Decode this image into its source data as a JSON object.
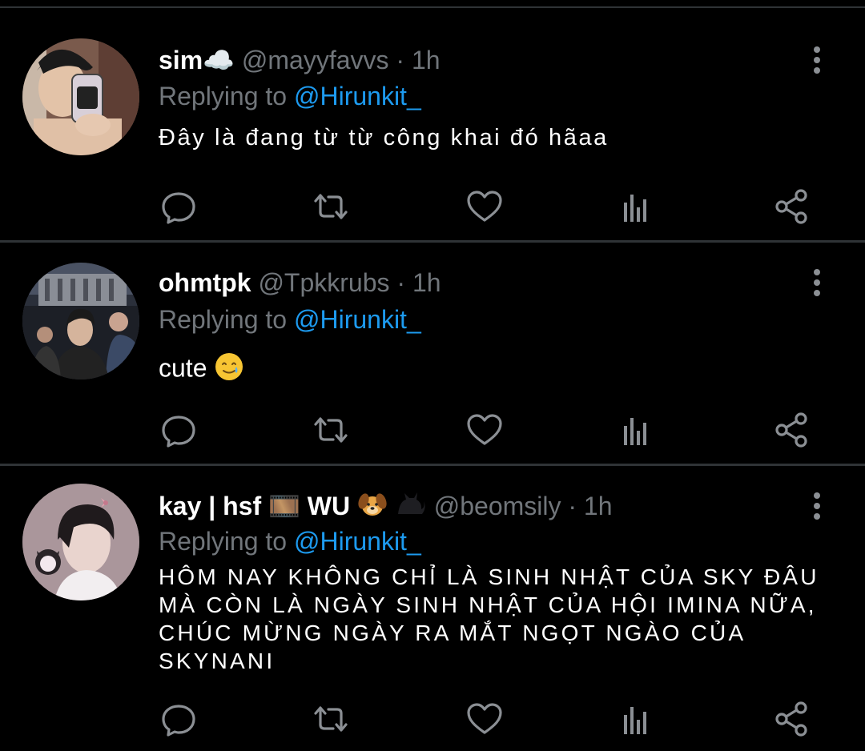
{
  "tweets": [
    {
      "name": "sim☁️",
      "handle": "@mayyfavvs",
      "dot": "·",
      "time": "1h",
      "replying_prefix": "Replying to",
      "mention": "@Hirunkit_",
      "text": "Đây là đang từ từ công khai đó hãaa"
    },
    {
      "name": "ohmtpk",
      "handle": "@Tpkkrubs",
      "dot": "·",
      "time": "1h",
      "replying_prefix": "Replying to",
      "mention": "@Hirunkit_",
      "text": "cute"
    },
    {
      "name": "kay | hsf 🎞️ WU",
      "handle": "@beomsily",
      "dot": "·",
      "time": "1h",
      "replying_prefix": "Replying to",
      "mention": "@Hirunkit_",
      "text": "HÔM NAY KHÔNG CHỈ LÀ SINH NHẬT CỦA SKY ĐÂU MÀ CÒN LÀ NGÀY SINH NHẬT CỦA HỘI IMINA NỮA, CHÚC MỪNG NGÀY RA MẮT NGỌT NGÀO CỦA SKYNANI"
    }
  ],
  "icons": {
    "reply": "reply-icon",
    "retweet": "retweet-icon",
    "like": "heart-icon",
    "views": "views-icon",
    "share": "share-icon",
    "more": "more-vertical-icon"
  },
  "colors": {
    "background": "#000000",
    "mention": "#1d9bf0",
    "secondary_text": "#71767b",
    "divider": "#2f3336"
  }
}
